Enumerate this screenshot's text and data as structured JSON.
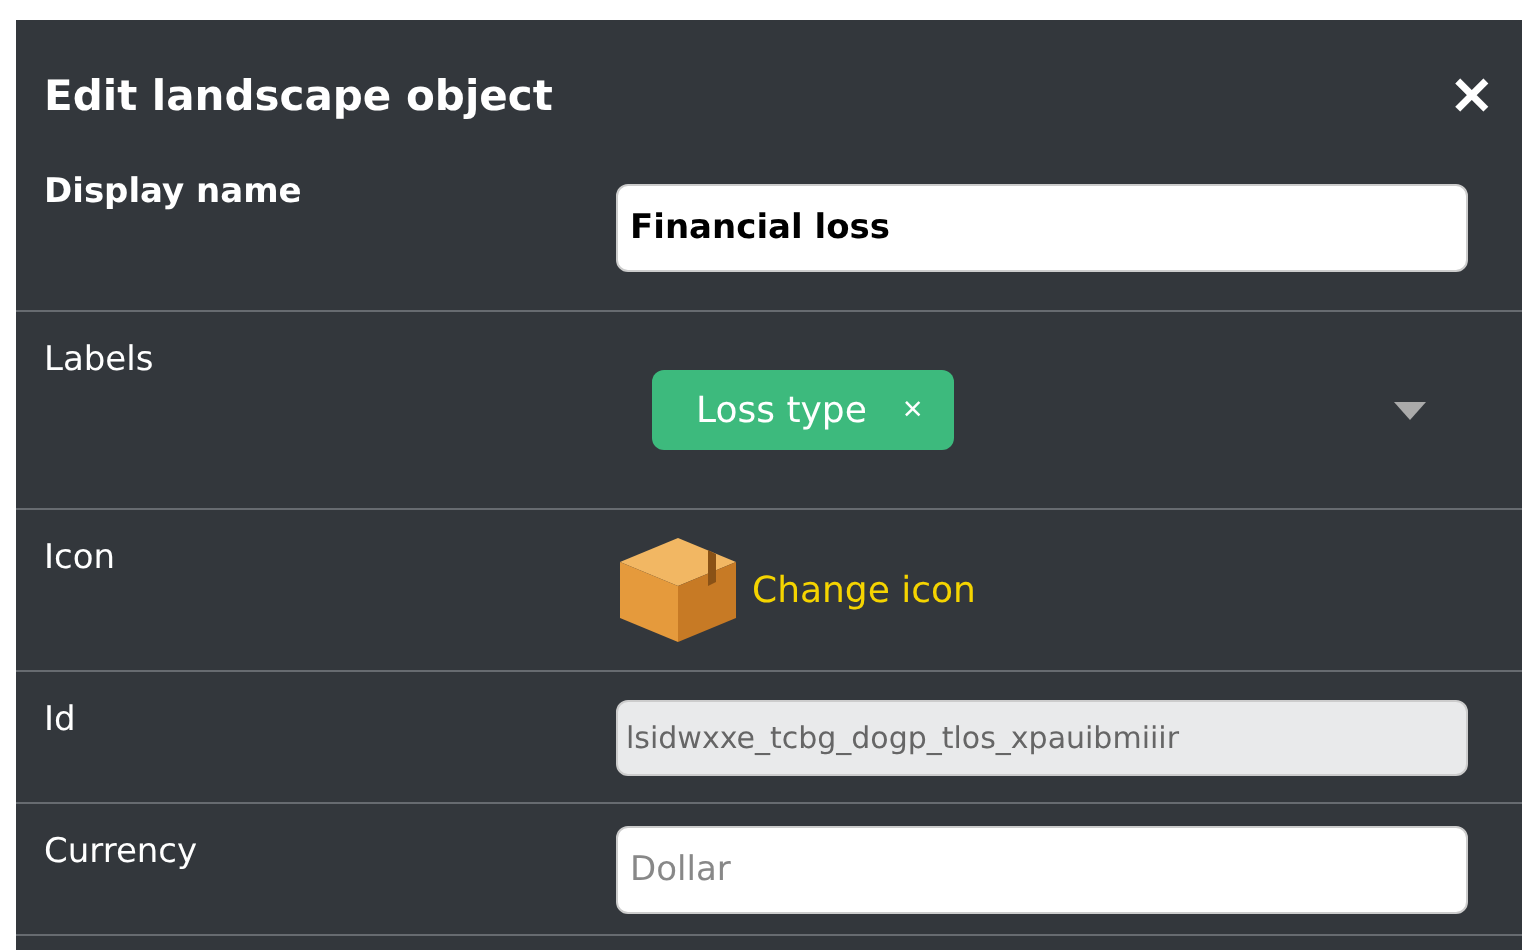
{
  "dialog": {
    "title": "Edit landscape object",
    "close": "✕"
  },
  "fields": [
    {
      "kind": "text",
      "label": "Display name",
      "bold": true,
      "value": "Financial loss"
    },
    {
      "kind": "tags",
      "label": "Labels",
      "tags": [
        {
          "label": "Loss type",
          "remove": "×",
          "color": "#3dba7d"
        }
      ]
    },
    {
      "kind": "icon",
      "label": "Icon",
      "action": "Change icon"
    },
    {
      "kind": "text",
      "label": "Id",
      "bold": false,
      "disabled": true,
      "value": "lsidwxxe_tcbg_dogp_tlos_xpauibmiiir"
    },
    {
      "kind": "text",
      "label": "Currency",
      "bold": false,
      "placeholder": "Dollar"
    }
  ]
}
